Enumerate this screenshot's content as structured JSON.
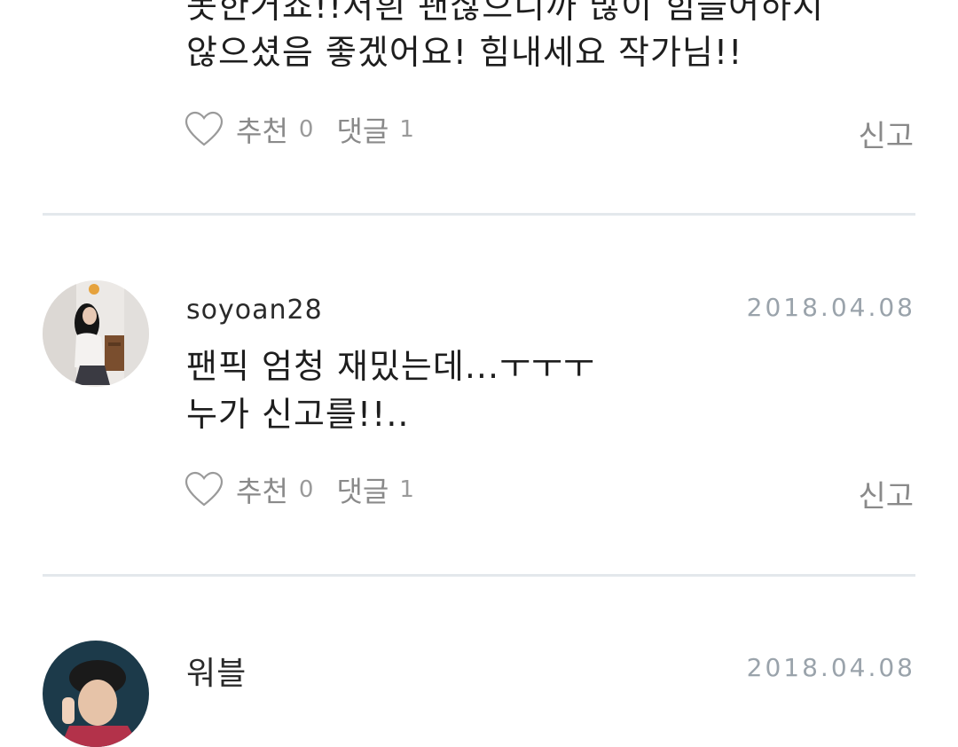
{
  "comments": [
    {
      "id": "c1",
      "body_lines": [
        "못한거죠!!저흰 괜찮으니까 많이 힘들어하지",
        "않으셨음 좋겠어요! 힘내세요 작가님!!"
      ],
      "like_label": "추천",
      "like_count": "0",
      "reply_label": "댓글",
      "reply_count": "1",
      "report_label": "신고"
    },
    {
      "id": "c2",
      "username": "soyoan28",
      "date": "2018.04.08",
      "body_lines": [
        " 팬픽 엄청 재밌는데...ㅜㅜㅜ",
        "누가 신고를!!.."
      ],
      "like_label": "추천",
      "like_count": "0",
      "reply_label": "댓글",
      "reply_count": "1",
      "report_label": "신고"
    },
    {
      "id": "c3",
      "username": "워블",
      "date": "2018.04.08"
    }
  ],
  "icons": {
    "like": "heart-outline-icon"
  },
  "colors": {
    "divider": "#e3e8ec",
    "muted": "#8a8a8a",
    "date": "#9aa3ab"
  }
}
